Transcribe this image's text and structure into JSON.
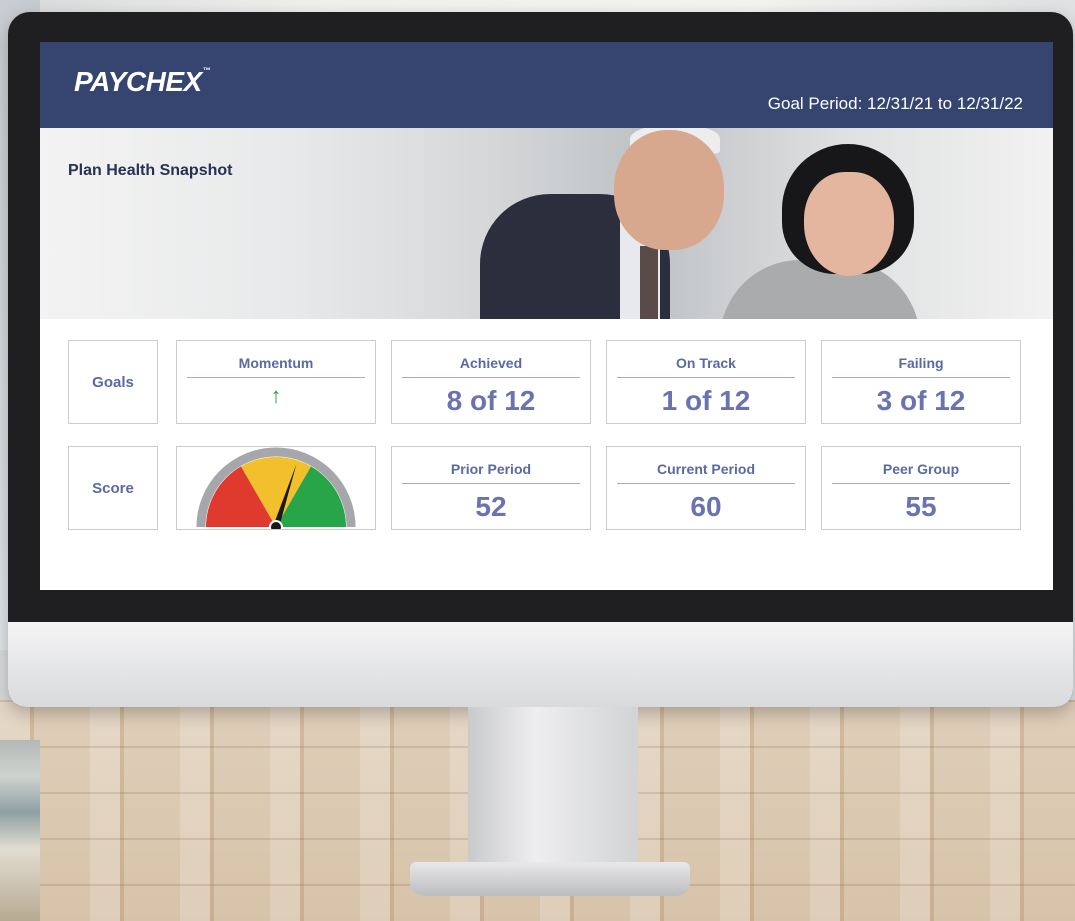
{
  "brand": {
    "logo_text": "PAYCHEX",
    "trademark": "™",
    "header_color": "#364470"
  },
  "header": {
    "goal_period": "Goal Period: 12/31/21 to 12/31/22"
  },
  "hero": {
    "title": "Plan Health Snapshot"
  },
  "rows": {
    "goals_label": "Goals",
    "score_label": "Score"
  },
  "goals": {
    "momentum": {
      "label": "Momentum",
      "icon": "arrow-up-icon",
      "value": "↑"
    },
    "achieved": {
      "label": "Achieved",
      "value": "8 of 12"
    },
    "on_track": {
      "label": "On Track",
      "value": "1 of 12"
    },
    "failing": {
      "label": "Failing",
      "value": "3 of 12"
    }
  },
  "score": {
    "gauge": {
      "icon": "gauge-icon",
      "level": 0.6,
      "colors": [
        "#e03a2f",
        "#f2c02d",
        "#27a548"
      ]
    },
    "prior_period": {
      "label": "Prior Period",
      "value": "52"
    },
    "current_period": {
      "label": "Current Period",
      "value": "60"
    },
    "peer_group": {
      "label": "Peer Group",
      "value": "55"
    }
  },
  "colors": {
    "label_text": "#5a6aa0",
    "value_text": "#6a72b0",
    "momentum_arrow": "#2f9a3e"
  }
}
